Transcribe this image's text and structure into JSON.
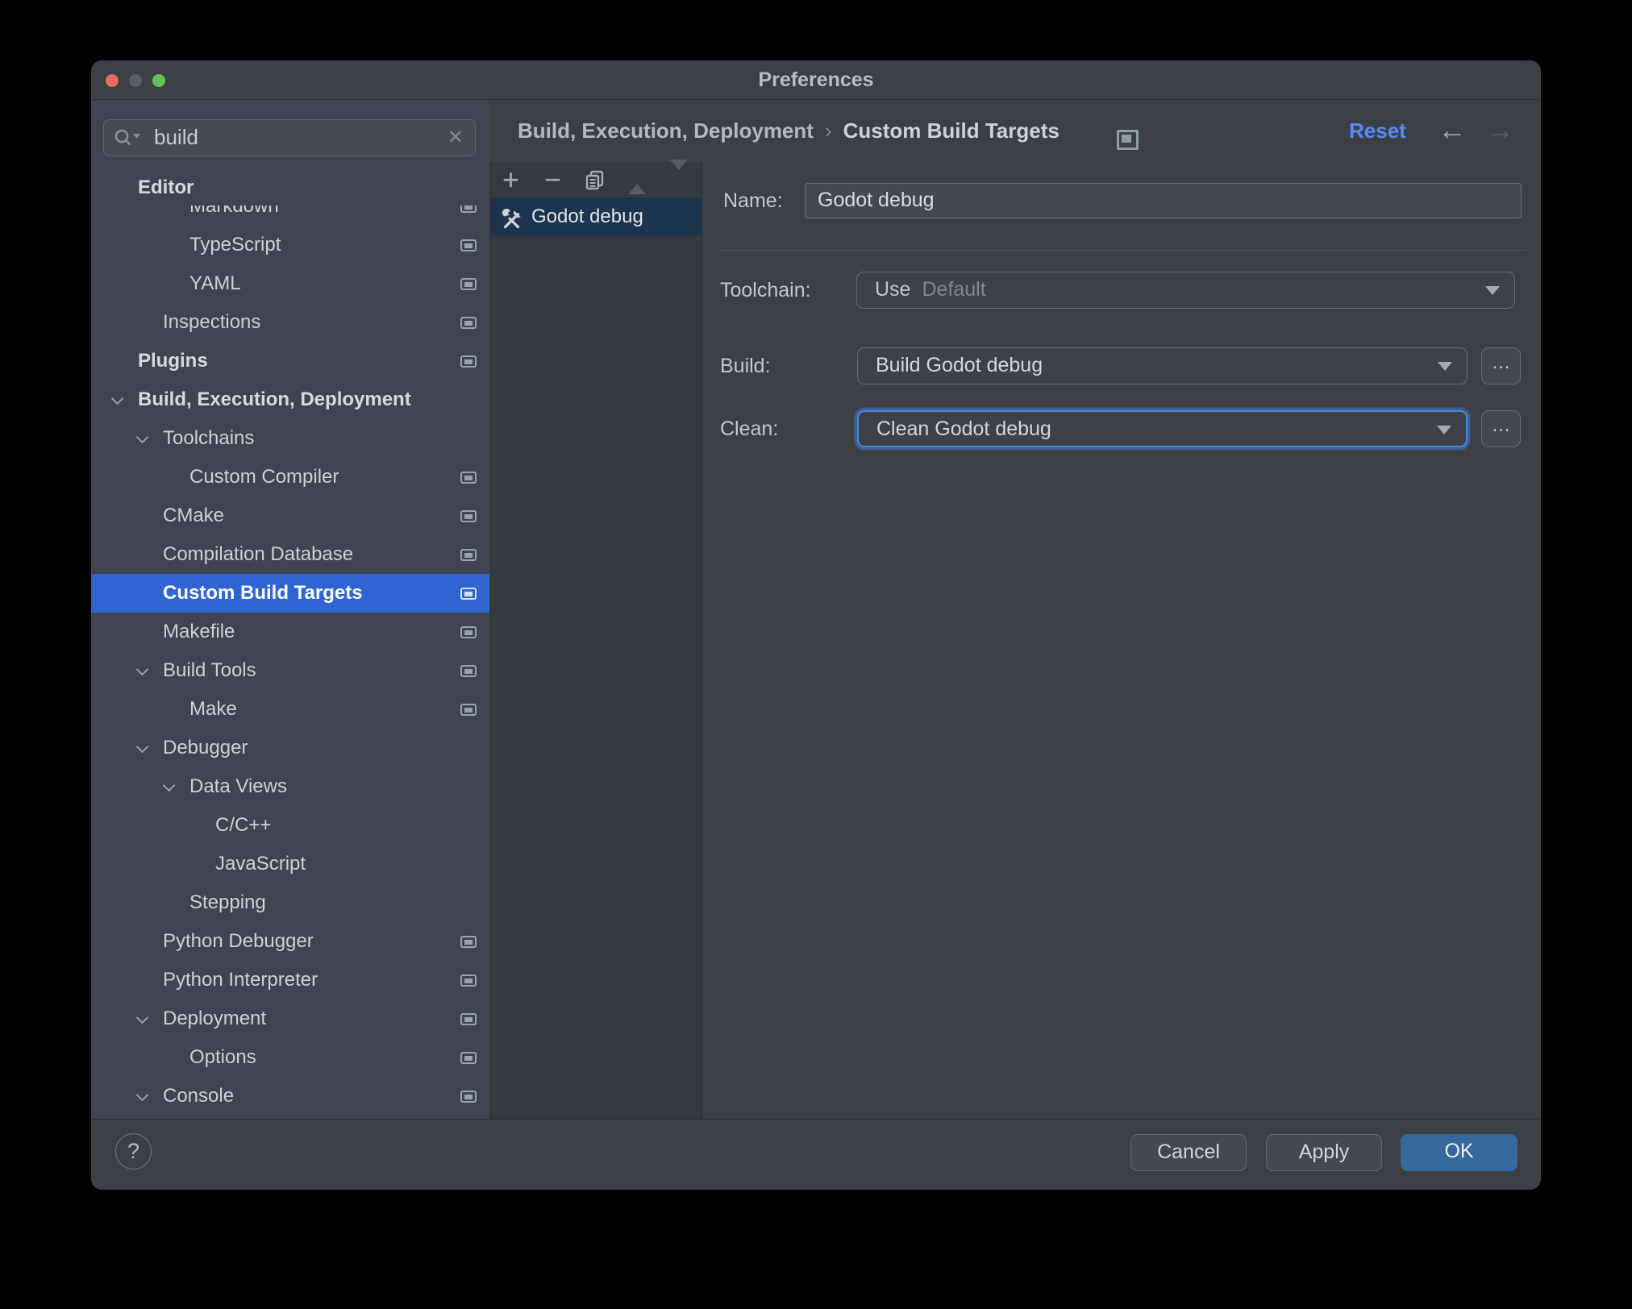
{
  "window": {
    "title": "Preferences"
  },
  "search": {
    "value": "build",
    "clear_glyph": "✕"
  },
  "tree": {
    "items": [
      {
        "label": "Editor",
        "level": 0,
        "bold": true,
        "chevron": false,
        "icon": false,
        "selected": false
      },
      {
        "label": "Markdown",
        "level": 2,
        "bold": false,
        "chevron": false,
        "icon": true,
        "selected": false
      },
      {
        "label": "TypeScript",
        "level": 2,
        "bold": false,
        "chevron": false,
        "icon": true,
        "selected": false
      },
      {
        "label": "YAML",
        "level": 2,
        "bold": false,
        "chevron": false,
        "icon": true,
        "selected": false
      },
      {
        "label": "Inspections",
        "level": 1,
        "bold": false,
        "chevron": false,
        "icon": true,
        "selected": false
      },
      {
        "label": "Plugins",
        "level": 0,
        "bold": true,
        "chevron": false,
        "icon": true,
        "selected": false
      },
      {
        "label": "Build, Execution, Deployment",
        "level": 0,
        "bold": true,
        "chevron": true,
        "icon": false,
        "selected": false
      },
      {
        "label": "Toolchains",
        "level": 1,
        "bold": false,
        "chevron": true,
        "icon": false,
        "selected": false
      },
      {
        "label": "Custom Compiler",
        "level": 2,
        "bold": false,
        "chevron": false,
        "icon": true,
        "selected": false
      },
      {
        "label": "CMake",
        "level": 1,
        "bold": false,
        "chevron": false,
        "icon": true,
        "selected": false
      },
      {
        "label": "Compilation Database",
        "level": 1,
        "bold": false,
        "chevron": false,
        "icon": true,
        "selected": false
      },
      {
        "label": "Custom Build Targets",
        "level": 1,
        "bold": false,
        "chevron": false,
        "icon": true,
        "selected": true
      },
      {
        "label": "Makefile",
        "level": 1,
        "bold": false,
        "chevron": false,
        "icon": true,
        "selected": false
      },
      {
        "label": "Build Tools",
        "level": 1,
        "bold": false,
        "chevron": true,
        "icon": true,
        "selected": false
      },
      {
        "label": "Make",
        "level": 2,
        "bold": false,
        "chevron": false,
        "icon": true,
        "selected": false
      },
      {
        "label": "Debugger",
        "level": 1,
        "bold": false,
        "chevron": true,
        "icon": false,
        "selected": false
      },
      {
        "label": "Data Views",
        "level": 2,
        "bold": false,
        "chevron": true,
        "icon": false,
        "selected": false
      },
      {
        "label": "C/C++",
        "level": 3,
        "bold": false,
        "chevron": false,
        "icon": false,
        "selected": false
      },
      {
        "label": "JavaScript",
        "level": 3,
        "bold": false,
        "chevron": false,
        "icon": false,
        "selected": false
      },
      {
        "label": "Stepping",
        "level": 2,
        "bold": false,
        "chevron": false,
        "icon": false,
        "selected": false
      },
      {
        "label": "Python Debugger",
        "level": 1,
        "bold": false,
        "chevron": false,
        "icon": true,
        "selected": false
      },
      {
        "label": "Python Interpreter",
        "level": 1,
        "bold": false,
        "chevron": false,
        "icon": true,
        "selected": false
      },
      {
        "label": "Deployment",
        "level": 1,
        "bold": false,
        "chevron": true,
        "icon": true,
        "selected": false
      },
      {
        "label": "Options",
        "level": 2,
        "bold": false,
        "chevron": false,
        "icon": true,
        "selected": false
      },
      {
        "label": "Console",
        "level": 1,
        "bold": false,
        "chevron": true,
        "icon": true,
        "selected": false
      }
    ]
  },
  "breadcrumb": {
    "part1": "Build, Execution, Deployment",
    "separator": "›",
    "part2": "Custom Build Targets"
  },
  "header": {
    "reset_label": "Reset",
    "back_glyph": "←",
    "forward_glyph": "→"
  },
  "targets": {
    "toolbar": {
      "add_glyph": "+",
      "remove_glyph": "−"
    },
    "items": [
      {
        "label": "Godot debug"
      }
    ]
  },
  "form": {
    "name_label": "Name:",
    "name_value": "Godot debug",
    "toolchain_label": "Toolchain:",
    "toolchain_use": "Use",
    "toolchain_value": "Default",
    "build_label": "Build:",
    "build_value": "Build Godot debug",
    "clean_label": "Clean:",
    "clean_value": "Clean Godot debug",
    "more_label": "…"
  },
  "footer": {
    "help_glyph": "?",
    "cancel_label": "Cancel",
    "apply_label": "Apply",
    "ok_label": "OK"
  },
  "colors": {
    "tree_selection_blue": "#2f64d3",
    "list_selection_navy": "#1c344f",
    "link_blue": "#548af7",
    "ok_button_blue": "#35689d",
    "focus_ring_blue": "#4c86d8"
  }
}
